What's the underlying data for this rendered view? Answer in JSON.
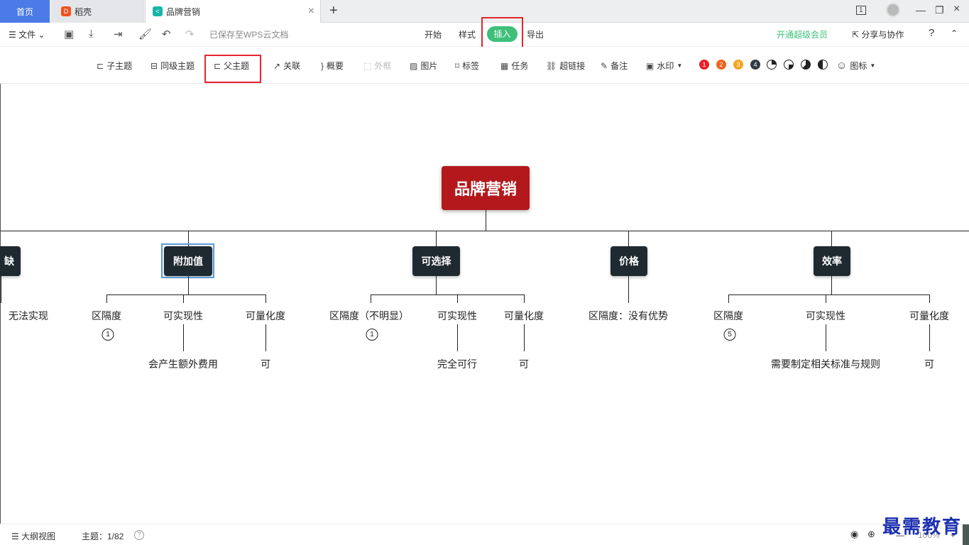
{
  "tabs": {
    "home": "首页",
    "docer": "稻壳",
    "current": "品牌营销"
  },
  "menubar": {
    "file": "文件",
    "saved_status": "已保存至WPS云文档",
    "tabs": [
      "开始",
      "样式",
      "插入",
      "导出"
    ],
    "vip": "开通超级会员",
    "share": "分享与协作",
    "help": "?"
  },
  "toolbar": {
    "items": [
      "子主题",
      "同级主题",
      "父主题",
      "关联",
      "概要",
      "外框",
      "图片",
      "标签",
      "任务",
      "超链接",
      "备注",
      "水印",
      "图标"
    ],
    "priority_dots": [
      "1",
      "2",
      "3",
      "4"
    ],
    "colors": {
      "dot1": "#e8212a",
      "dot2": "#f2621e",
      "dot3": "#f5a623",
      "dot4": "#333a40"
    }
  },
  "mindmap": {
    "root": "品牌营销",
    "branches": [
      "缺",
      "附加值",
      "可选择",
      "价格",
      "效率"
    ],
    "leaves": {
      "b0": [
        "无法实现"
      ],
      "b1": [
        "区隔度",
        "可实现性",
        "可量化度"
      ],
      "b1_sub": [
        "会产生额外费用",
        "可"
      ],
      "b2": [
        "区隔度（不明显）",
        "可实现性",
        "可量化度"
      ],
      "b2_sub": [
        "完全可行",
        "可"
      ],
      "b3": [
        "区隔度：没有优势"
      ],
      "b4": [
        "区隔度",
        "可实现性",
        "可量化度"
      ],
      "b4_sub": [
        "需要制定相关标准与规则",
        "可"
      ]
    },
    "badges": [
      "1",
      "1",
      "5"
    ]
  },
  "statusbar": {
    "outline_view": "大纲视图",
    "topic_count": "主题：1/82",
    "zoom": "100%"
  },
  "watermark": "最需教育",
  "colors": {
    "accent": "#3ebf7a",
    "root": "#b3191c",
    "node": "#1e2a30",
    "highlight": "#e3262f"
  }
}
